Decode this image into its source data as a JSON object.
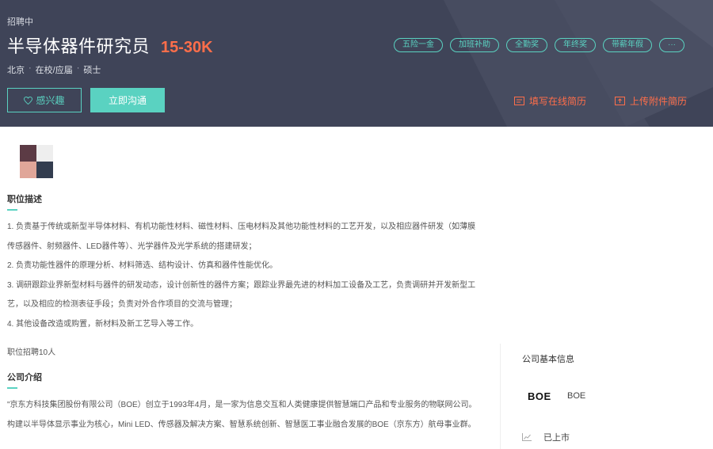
{
  "header": {
    "status": "招聘中",
    "job_title": "半导体器件研究员",
    "salary": "15-30K",
    "meta": [
      "北京",
      "在校/应届",
      "硕士"
    ],
    "tags": [
      "五险一金",
      "加班补助",
      "全勤奖",
      "年终奖",
      "带薪年假",
      "···"
    ],
    "interest_button": "感兴趣",
    "interest_icon": "heart-icon",
    "chat_button": "立即沟通",
    "fill_resume": "填写在线简历",
    "upload_resume": "上传附件简历",
    "colors": {
      "bg": "#3f4458",
      "accent": "#5ad2c1",
      "salary": "#ff6e4a"
    }
  },
  "logo_colors": [
    "#5c3b45",
    "#eeeeee",
    "#e0a699",
    "#333d4f"
  ],
  "description": {
    "title": "职位描述",
    "lines": [
      "1. 负责基于传统或新型半导体材料、有机功能性材料、磁性材料、压电材料及其他功能性材料的工艺开发，以及相应器件研发（如薄膜",
      "传感器件、射频器件、LED器件等）、光学器件及光学系统的搭建研发；",
      "2. 负责功能性器件的原理分析、材料筛选、结构设计、仿真和器件性能优化。",
      "3. 调研跟踪业界新型材料与器件的研发动态，设计创新性的器件方案；跟踪业界最先进的材料加工设备及工艺，负责调研并开发新型工",
      "艺，以及相应的检测表征手段；负责对外合作项目的交流与管理；",
      "4. 其他设备改造或购置，新材料及新工艺导入等工作。"
    ],
    "headcount": "职位招聘10人"
  },
  "company_intro": {
    "title": "公司介绍",
    "lines": [
      "\"京东方科技集团股份有限公司（BOE）创立于1993年4月，是一家为信息交互和人类健康提供智慧端口产品和专业服务的物联网公司。",
      "构建以半导体显示事业为核心，Mini LED、传感器及解决方案、智慧系统创新、智慧医工事业融合发展的BOE（京东方）航母事业群。"
    ]
  },
  "sidebar": {
    "title": "公司基本信息",
    "logo_text": "BOE",
    "company_name": "BOE",
    "listed_icon": "chart-line-icon",
    "listed": "已上市"
  }
}
